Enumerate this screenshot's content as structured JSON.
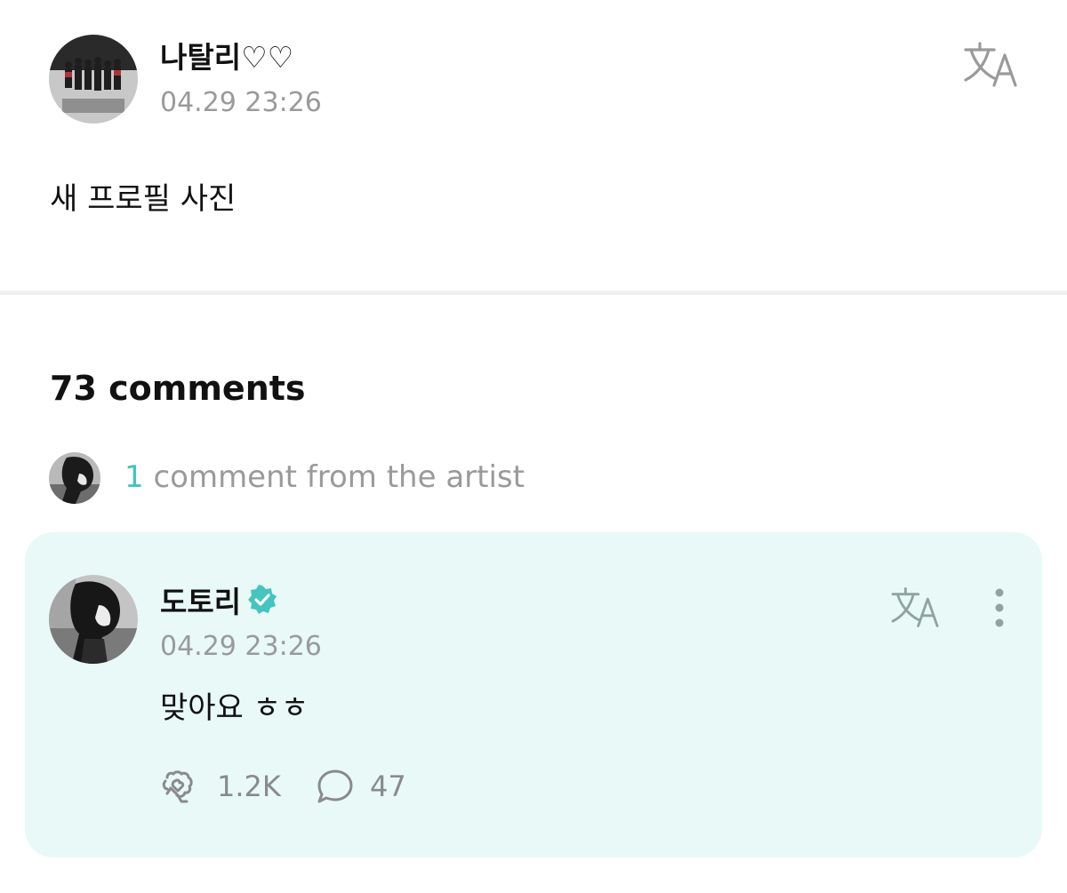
{
  "post": {
    "author": "나탈리♡♡",
    "time": "04.29 23:26",
    "body": "새 프로필 사진",
    "translate_icon": "translate-icon"
  },
  "comments": {
    "title": "73 comments",
    "artist_summary": {
      "count": "1",
      "label": " comment from the artist"
    }
  },
  "artist_comment": {
    "author": "도토리",
    "verified_icon": "verified-badge-icon",
    "time": "04.29 23:26",
    "body": "맞아요 ㅎㅎ",
    "likes": "1.2K",
    "replies": "47",
    "like_icon": "like-icon",
    "reply_icon": "speech-bubble-icon",
    "more_icon": "more-vertical-icon"
  },
  "colors": {
    "accent": "#45c4c0",
    "card_bg": "#e8f9f7",
    "muted_text": "#9a9a9a",
    "divider": "#f0f0f0"
  }
}
